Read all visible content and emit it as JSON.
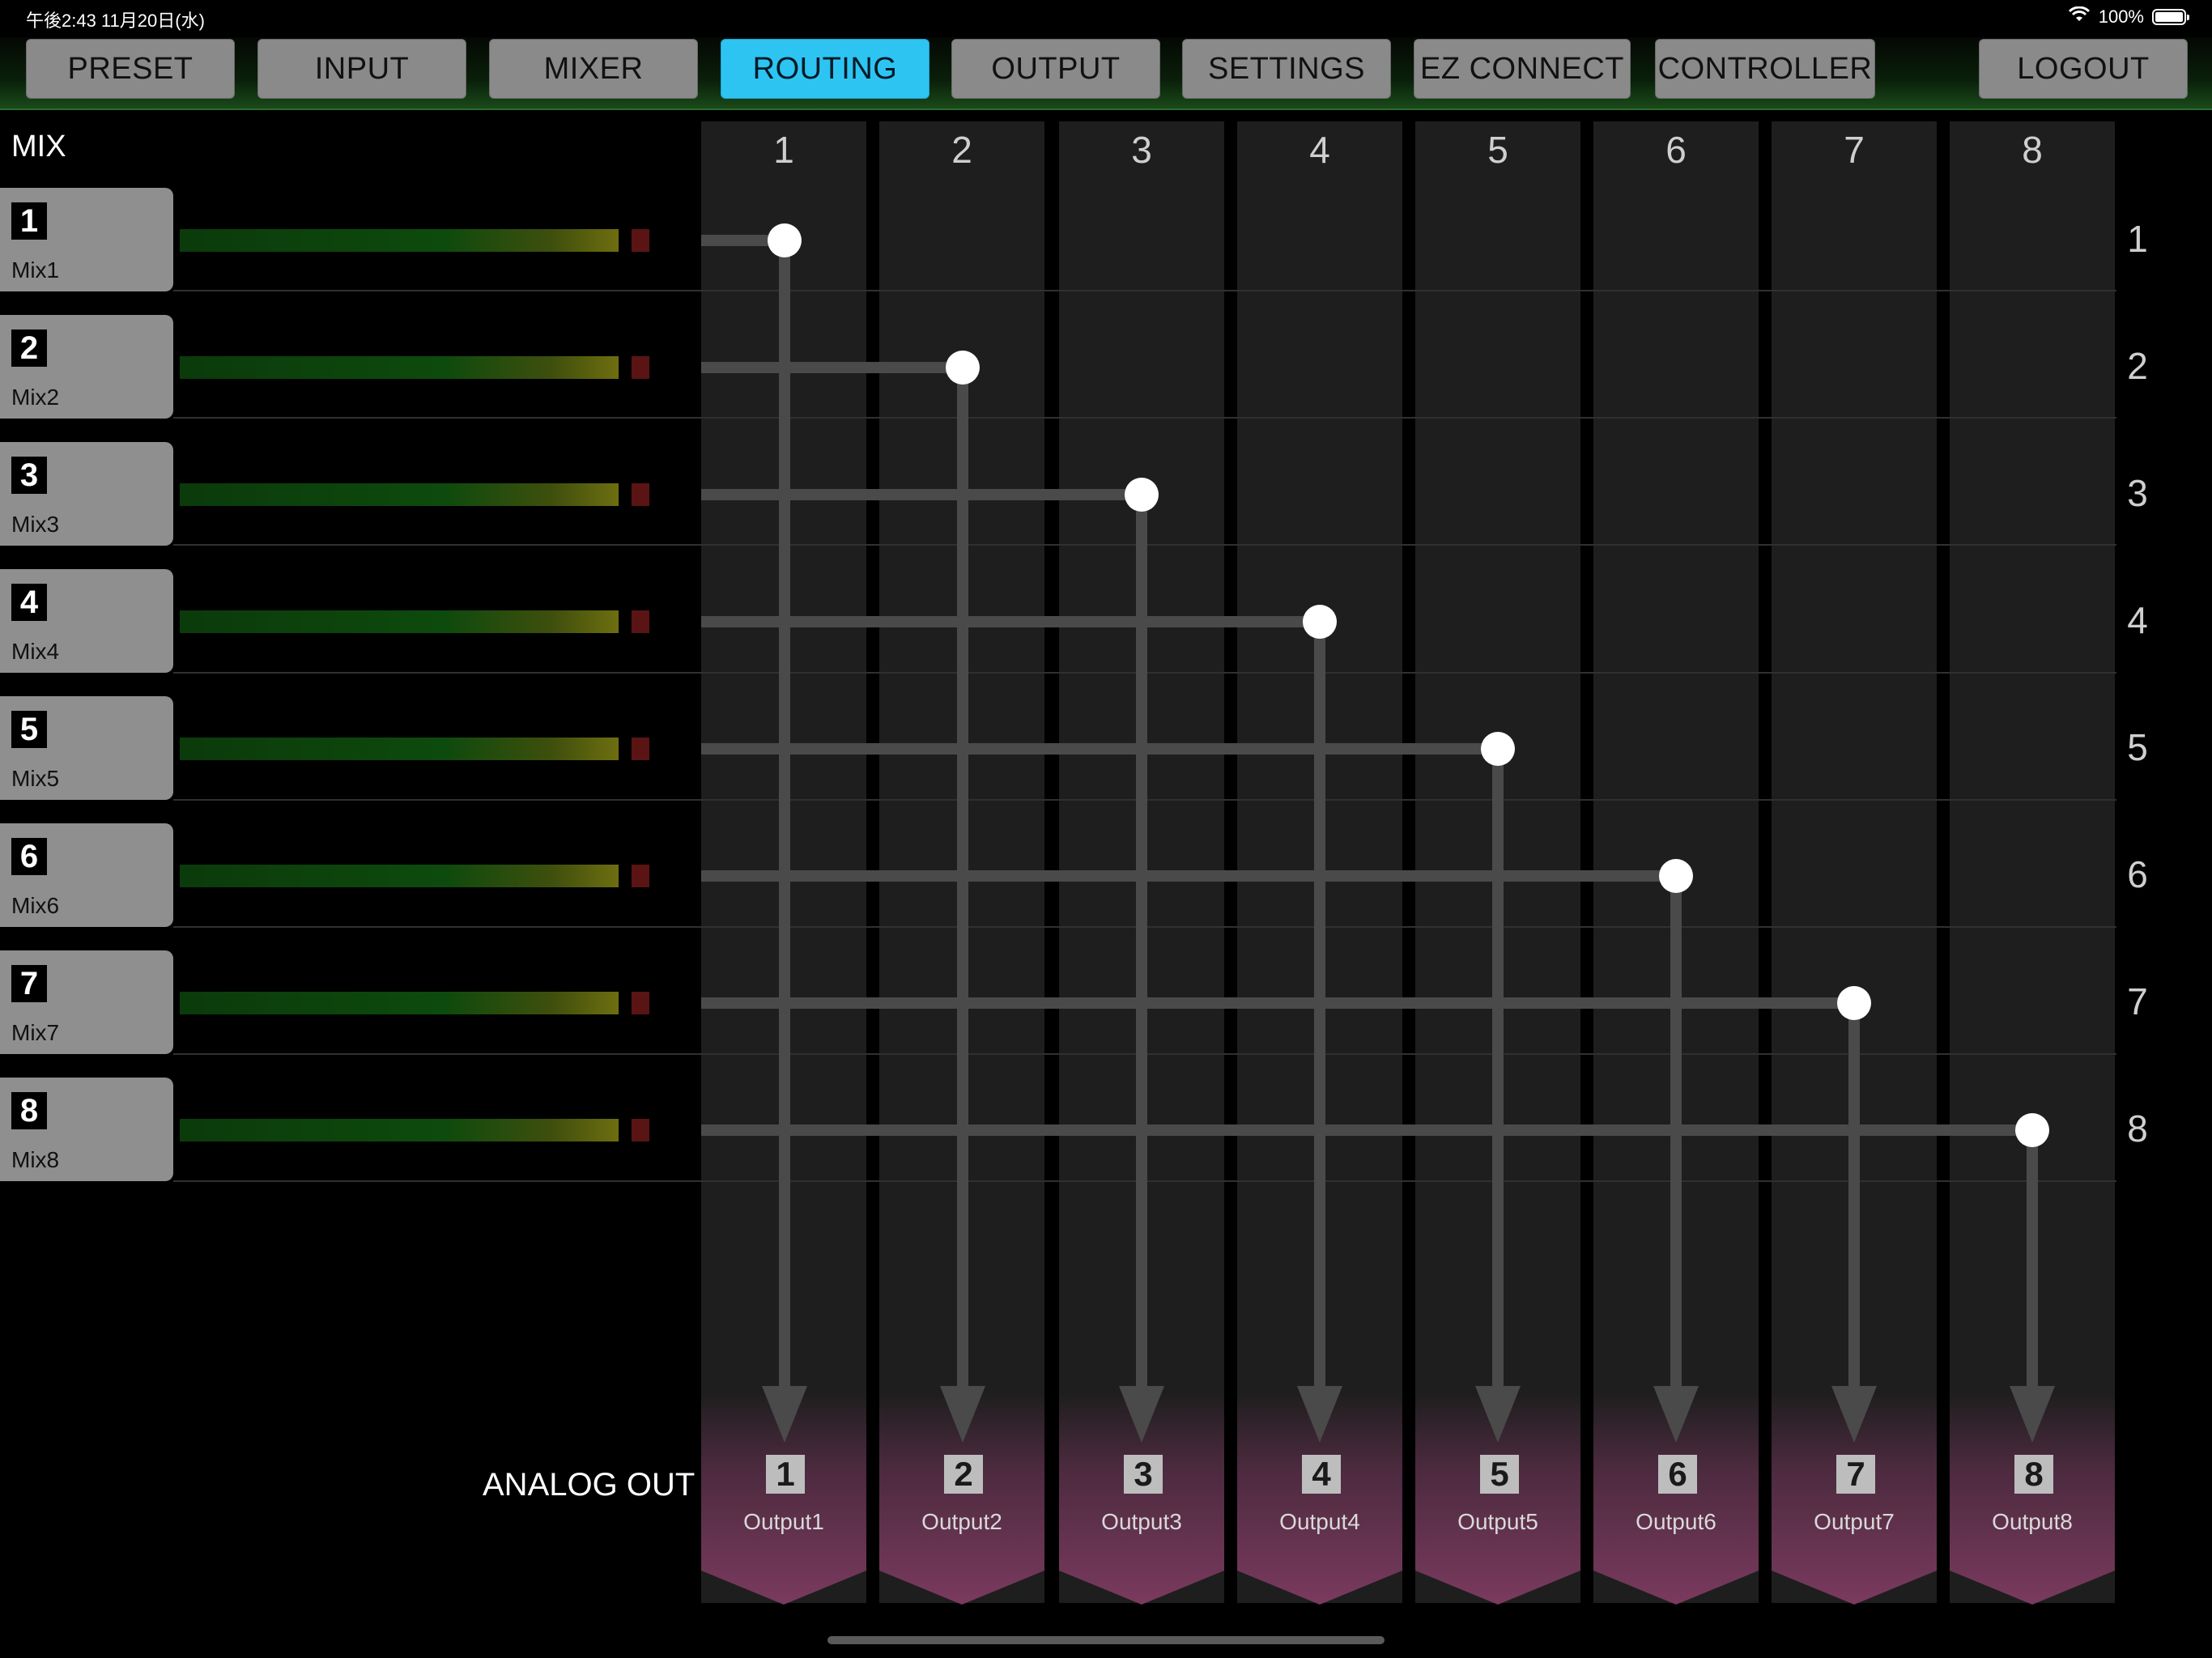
{
  "status_bar": {
    "time_date": "午後2:43  11月20日(水)",
    "battery_text": "100%"
  },
  "tabs": [
    {
      "label": "PRESET",
      "active": false
    },
    {
      "label": "INPUT",
      "active": false
    },
    {
      "label": "MIXER",
      "active": false
    },
    {
      "label": "ROUTING",
      "active": true
    },
    {
      "label": "OUTPUT",
      "active": false
    },
    {
      "label": "SETTINGS",
      "active": false
    },
    {
      "label": "EZ CONNECT",
      "active": false
    },
    {
      "label": "CONTROLLER",
      "active": false
    },
    {
      "label": "LOGOUT",
      "active": false
    }
  ],
  "mix_section": {
    "title": "MIX",
    "mixes": [
      {
        "number": "1",
        "name": "Mix1"
      },
      {
        "number": "2",
        "name": "Mix2"
      },
      {
        "number": "3",
        "name": "Mix3"
      },
      {
        "number": "4",
        "name": "Mix4"
      },
      {
        "number": "5",
        "name": "Mix5"
      },
      {
        "number": "6",
        "name": "Mix6"
      },
      {
        "number": "7",
        "name": "Mix7"
      },
      {
        "number": "8",
        "name": "Mix8"
      }
    ]
  },
  "matrix": {
    "column_labels": [
      "1",
      "2",
      "3",
      "4",
      "5",
      "6",
      "7",
      "8"
    ],
    "row_labels": [
      "1",
      "2",
      "3",
      "4",
      "5",
      "6",
      "7",
      "8"
    ],
    "routing": [
      [
        1,
        1
      ],
      [
        2,
        2
      ],
      [
        3,
        3
      ],
      [
        4,
        4
      ],
      [
        5,
        5
      ],
      [
        6,
        6
      ],
      [
        7,
        7
      ],
      [
        8,
        8
      ]
    ]
  },
  "outputs": {
    "label": "ANALOG OUT",
    "items": [
      {
        "number": "1",
        "name": "Output1"
      },
      {
        "number": "2",
        "name": "Output2"
      },
      {
        "number": "3",
        "name": "Output3"
      },
      {
        "number": "4",
        "name": "Output4"
      },
      {
        "number": "5",
        "name": "Output5"
      },
      {
        "number": "6",
        "name": "Output6"
      },
      {
        "number": "7",
        "name": "Output7"
      },
      {
        "number": "8",
        "name": "Output8"
      }
    ]
  },
  "colors": {
    "active_tab": "#2ec4f2",
    "tab": "#8a8a8a",
    "line": "#4a4a4a",
    "node": "#ffffff",
    "output_tile": "#6b3455"
  }
}
